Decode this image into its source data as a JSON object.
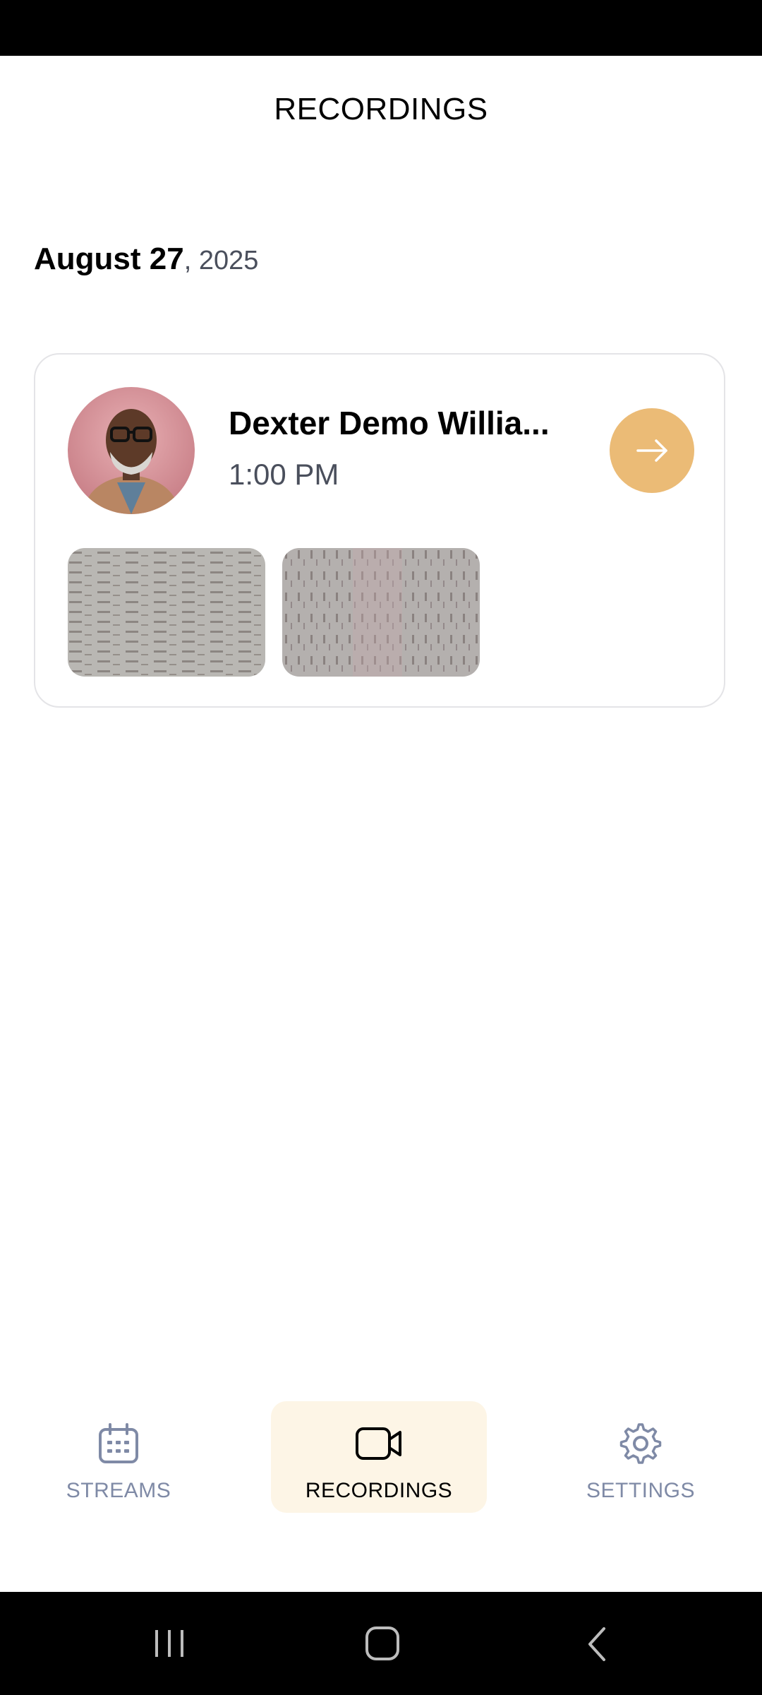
{
  "header": {
    "title": "RECORDINGS"
  },
  "date_group": {
    "day": "August 27",
    "year": ", 2025"
  },
  "recording": {
    "name": "Dexter Demo Willia...",
    "time": "1:00 PM"
  },
  "bottom_nav": {
    "items": [
      {
        "label": "STREAMS",
        "icon": "calendar-icon",
        "active": false
      },
      {
        "label": "RECORDINGS",
        "icon": "video-camera-icon",
        "active": true
      },
      {
        "label": "SETTINGS",
        "icon": "gear-icon",
        "active": false
      }
    ]
  },
  "colors": {
    "accent": "#ebbb76",
    "active_tab_bg": "#fdf5e6",
    "inactive_nav": "#7f8aa6",
    "muted_text": "#4a4f5c"
  }
}
